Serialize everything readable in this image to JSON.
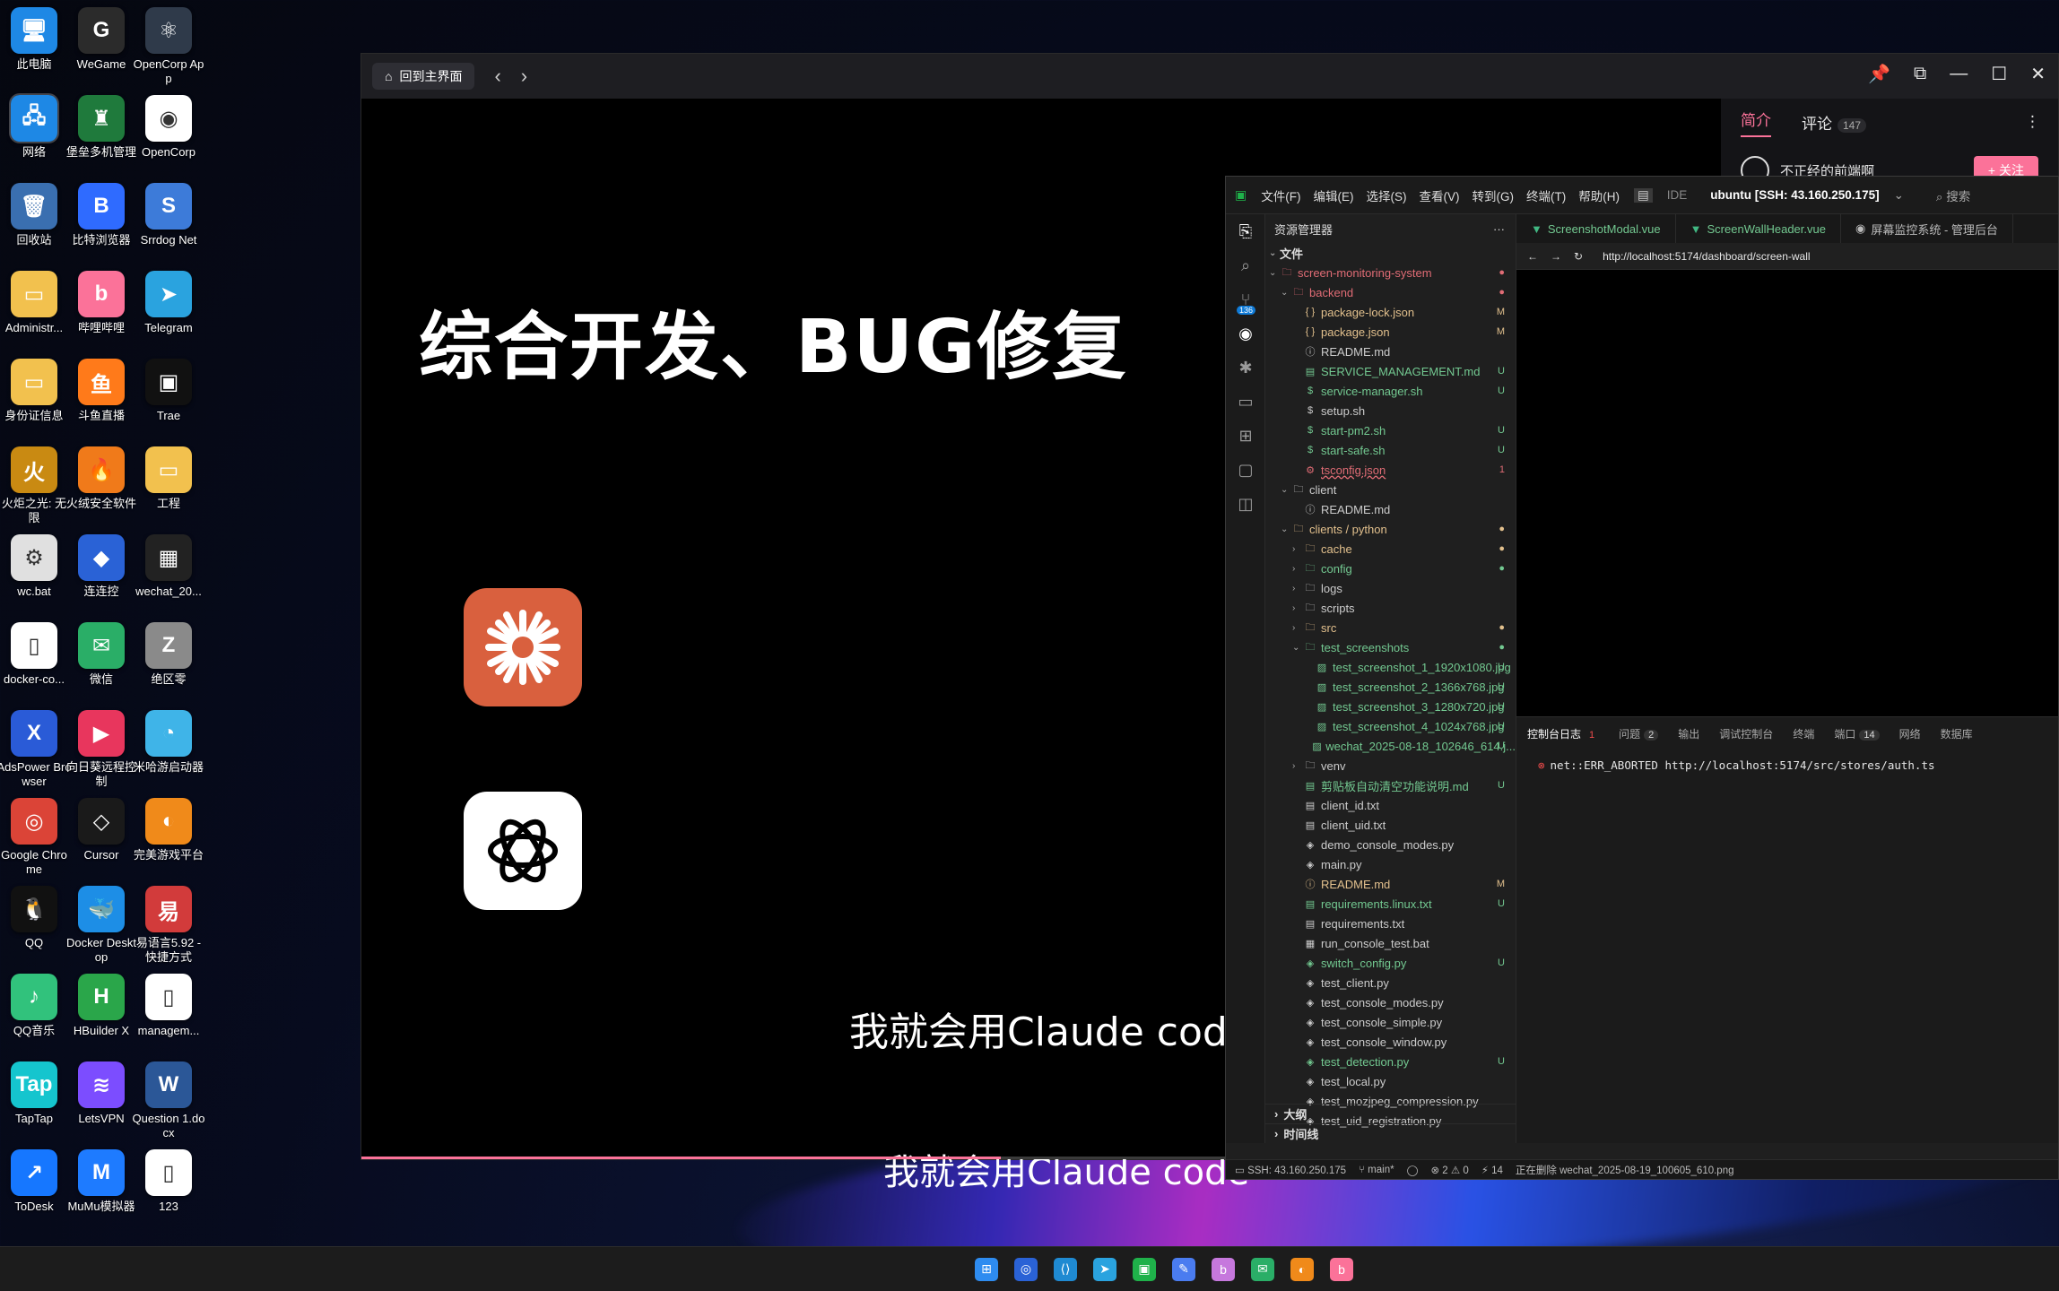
{
  "desktop": {
    "icons": [
      {
        "label": "此电脑",
        "glyph": "🖥",
        "color": "#1e88e5"
      },
      {
        "label": "WeGame",
        "glyph": "G",
        "color": "#2b2b2b"
      },
      {
        "label": "OpenCorp App",
        "glyph": "⚛",
        "color": "#2f3a4a"
      },
      {
        "label": "网络",
        "glyph": "🖧",
        "color": "#1e88e5"
      },
      {
        "label": "堡垒多机管理",
        "glyph": "♜",
        "color": "#1f7a3c"
      },
      {
        "label": "OpenCorp",
        "glyph": "◉",
        "color": "#ffffff"
      },
      {
        "label": "回收站",
        "glyph": "🗑",
        "color": "#3a6fb0"
      },
      {
        "label": "比特浏览器",
        "glyph": "B",
        "color": "#2f6bff"
      },
      {
        "label": "Srrdog Net",
        "glyph": "S",
        "color": "#3d7bd9"
      },
      {
        "label": "Administr...",
        "glyph": "▭",
        "color": "#f2c14e"
      },
      {
        "label": "哔哩哔哩",
        "glyph": "b",
        "color": "#fb7299"
      },
      {
        "label": "Telegram",
        "glyph": "➤",
        "color": "#2aa3df"
      },
      {
        "label": "身份证信息",
        "glyph": "▭",
        "color": "#f2c14e"
      },
      {
        "label": "斗鱼直播",
        "glyph": "鱼",
        "color": "#ff7a1a"
      },
      {
        "label": "Trae",
        "glyph": "▣",
        "color": "#111111"
      },
      {
        "label": "火炬之光: 无限",
        "glyph": "火",
        "color": "#c98a12"
      },
      {
        "label": "火绒安全软件",
        "glyph": "🔥",
        "color": "#f07a1a"
      },
      {
        "label": "工程",
        "glyph": "▭",
        "color": "#f2c14e"
      },
      {
        "label": "wc.bat",
        "glyph": "⚙",
        "color": "#e0e0e0"
      },
      {
        "label": "连连控",
        "glyph": "◆",
        "color": "#2a62d6"
      },
      {
        "label": "wechat_20...",
        "glyph": "▦",
        "color": "#222222"
      },
      {
        "label": "docker-co...",
        "glyph": "▯",
        "color": "#ffffff"
      },
      {
        "label": "微信",
        "glyph": "✉",
        "color": "#2aae67"
      },
      {
        "label": "绝区零",
        "glyph": "Z",
        "color": "#8a8a8a"
      },
      {
        "label": "AdsPower Browser",
        "glyph": "X",
        "color": "#2a5bd7"
      },
      {
        "label": "向日葵远程控制",
        "glyph": "▶",
        "color": "#e8365d"
      },
      {
        "label": "米哈游启动器",
        "glyph": "◔",
        "color": "#3fb4e8"
      },
      {
        "label": "Google Chrome",
        "glyph": "◎",
        "color": "#db4437"
      },
      {
        "label": "Cursor",
        "glyph": "◇",
        "color": "#1a1a1a"
      },
      {
        "label": "完美游戏平台",
        "glyph": "◐",
        "color": "#f08a1a"
      },
      {
        "label": "QQ",
        "glyph": "🐧",
        "color": "#111111"
      },
      {
        "label": "Docker Desktop",
        "glyph": "🐳",
        "color": "#1d8ee6"
      },
      {
        "label": "易语言5.92 - 快捷方式",
        "glyph": "易",
        "color": "#d23b3b"
      },
      {
        "label": "QQ音乐",
        "glyph": "♪",
        "color": "#31c27c"
      },
      {
        "label": "HBuilder X",
        "glyph": "H",
        "color": "#2aa64a"
      },
      {
        "label": "managem...",
        "glyph": "▯",
        "color": "#ffffff"
      },
      {
        "label": "TapTap",
        "glyph": "Tap",
        "color": "#15c5ce"
      },
      {
        "label": "LetsVPN",
        "glyph": "≋",
        "color": "#7c4dff"
      },
      {
        "label": "Question 1.docx",
        "glyph": "W",
        "color": "#2b5797"
      },
      {
        "label": "ToDesk",
        "glyph": "↗",
        "color": "#1677ff"
      },
      {
        "label": "MuMu模拟器",
        "glyph": "M",
        "color": "#1e7bff"
      },
      {
        "label": "123",
        "glyph": "▯",
        "color": "#ffffff"
      }
    ]
  },
  "player": {
    "home_label": "回到主界面",
    "video_title": "综合开发、BUG修复",
    "subtitle_1": "我就会用Claude code",
    "subtitle_2": "我就会用Claude code",
    "progress": 0.47,
    "tab_intro": "简介",
    "tab_comments": "评论",
    "comment_count": "147",
    "uploader_name": "不正经的前端啊",
    "follow_label": "+ 关注"
  },
  "ide": {
    "menus": [
      "文件(F)",
      "编辑(E)",
      "选择(S)",
      "查看(V)",
      "转到(G)",
      "终端(T)",
      "帮助(H)"
    ],
    "mode_label": "IDE",
    "ssh_label": "ubuntu [SSH: 43.160.250.175]",
    "search_label": "搜索",
    "explorer_title": "资源管理器",
    "files_section": "文件",
    "activity_badge": "136",
    "tree": [
      {
        "depth": 0,
        "type": "folder",
        "open": true,
        "name": "screen-monitoring-system",
        "color": "c-red",
        "status": "●",
        "status_color": "c-red"
      },
      {
        "depth": 1,
        "type": "folder",
        "open": true,
        "name": "backend",
        "color": "c-red",
        "status": "●",
        "status_color": "c-red"
      },
      {
        "depth": 2,
        "type": "file",
        "icon": "{ }",
        "name": "package-lock.json",
        "color": "c-yellow",
        "status": "M",
        "status_color": "c-m"
      },
      {
        "depth": 2,
        "type": "file",
        "icon": "{ }",
        "name": "package.json",
        "color": "c-yellow",
        "status": "M",
        "status_color": "c-m"
      },
      {
        "depth": 2,
        "type": "file",
        "icon": "ⓘ",
        "name": "README.md",
        "color": "c-white",
        "status": "",
        "status_color": "c-u"
      },
      {
        "depth": 2,
        "type": "file",
        "icon": "▤",
        "name": "SERVICE_MANAGEMENT.md",
        "color": "c-green",
        "status": "U",
        "status_color": "c-u"
      },
      {
        "depth": 2,
        "type": "file",
        "icon": "$",
        "name": "service-manager.sh",
        "color": "c-green",
        "status": "U",
        "status_color": "c-u"
      },
      {
        "depth": 2,
        "type": "file",
        "icon": "$",
        "name": "setup.sh",
        "color": "c-white",
        "status": "",
        "status_color": "c-u"
      },
      {
        "depth": 2,
        "type": "file",
        "icon": "$",
        "name": "start-pm2.sh",
        "color": "c-green",
        "status": "U",
        "status_color": "c-u"
      },
      {
        "depth": 2,
        "type": "file",
        "icon": "$",
        "name": "start-safe.sh",
        "color": "c-green",
        "status": "U",
        "status_color": "c-u"
      },
      {
        "depth": 2,
        "type": "file",
        "icon": "⚙",
        "name": "tsconfig.json",
        "color": "c-red",
        "status": "1",
        "status_color": "c-red"
      },
      {
        "depth": 1,
        "type": "folder",
        "open": true,
        "name": "client",
        "color": "c-white",
        "status": "",
        "status_color": "c-u"
      },
      {
        "depth": 2,
        "type": "file",
        "icon": "ⓘ",
        "name": "README.md",
        "color": "c-white",
        "status": "",
        "status_color": "c-u"
      },
      {
        "depth": 1,
        "type": "folder",
        "open": true,
        "name": "clients / python",
        "color": "c-yellow",
        "status": "●",
        "status_color": "c-m"
      },
      {
        "depth": 2,
        "type": "folder",
        "open": false,
        "name": "cache",
        "color": "c-yellow",
        "status": "●",
        "status_color": "c-m"
      },
      {
        "depth": 2,
        "type": "folder",
        "open": false,
        "name": "config",
        "color": "c-green",
        "status": "●",
        "status_color": "c-u"
      },
      {
        "depth": 2,
        "type": "folder",
        "open": false,
        "name": "logs",
        "color": "c-white",
        "status": "",
        "status_color": "c-u"
      },
      {
        "depth": 2,
        "type": "folder",
        "open": false,
        "name": "scripts",
        "color": "c-white",
        "status": "",
        "status_color": "c-u"
      },
      {
        "depth": 2,
        "type": "folder",
        "open": false,
        "name": "src",
        "color": "c-yellow",
        "status": "●",
        "status_color": "c-m"
      },
      {
        "depth": 2,
        "type": "folder",
        "open": true,
        "name": "test_screenshots",
        "color": "c-green",
        "status": "●",
        "status_color": "c-u"
      },
      {
        "depth": 3,
        "type": "file",
        "icon": "▨",
        "name": "test_screenshot_1_1920x1080.jpg",
        "color": "c-green",
        "status": "U",
        "status_color": "c-u"
      },
      {
        "depth": 3,
        "type": "file",
        "icon": "▨",
        "name": "test_screenshot_2_1366x768.jpg",
        "color": "c-green",
        "status": "U",
        "status_color": "c-u"
      },
      {
        "depth": 3,
        "type": "file",
        "icon": "▨",
        "name": "test_screenshot_3_1280x720.jpg",
        "color": "c-green",
        "status": "U",
        "status_color": "c-u"
      },
      {
        "depth": 3,
        "type": "file",
        "icon": "▨",
        "name": "test_screenshot_4_1024x768.jpg",
        "color": "c-green",
        "status": "U",
        "status_color": "c-u"
      },
      {
        "depth": 3,
        "type": "file",
        "icon": "▨",
        "name": "wechat_2025-08-18_102646_614.j...",
        "color": "c-green",
        "status": "U",
        "status_color": "c-u"
      },
      {
        "depth": 2,
        "type": "folder",
        "open": false,
        "name": "venv",
        "color": "c-white",
        "status": "",
        "status_color": "c-u"
      },
      {
        "depth": 2,
        "type": "file",
        "icon": "▤",
        "name": "剪贴板自动清空功能说明.md",
        "color": "c-green",
        "status": "U",
        "status_color": "c-u"
      },
      {
        "depth": 2,
        "type": "file",
        "icon": "▤",
        "name": "client_id.txt",
        "color": "c-white",
        "status": "",
        "status_color": "c-u"
      },
      {
        "depth": 2,
        "type": "file",
        "icon": "▤",
        "name": "client_uid.txt",
        "color": "c-white",
        "status": "",
        "status_color": "c-u"
      },
      {
        "depth": 2,
        "type": "file",
        "icon": "◈",
        "name": "demo_console_modes.py",
        "color": "c-white",
        "status": "",
        "status_color": "c-u"
      },
      {
        "depth": 2,
        "type": "file",
        "icon": "◈",
        "name": "main.py",
        "color": "c-white",
        "status": "",
        "status_color": "c-u"
      },
      {
        "depth": 2,
        "type": "file",
        "icon": "ⓘ",
        "name": "README.md",
        "color": "c-yellow",
        "status": "M",
        "status_color": "c-m"
      },
      {
        "depth": 2,
        "type": "file",
        "icon": "▤",
        "name": "requirements.linux.txt",
        "color": "c-green",
        "status": "U",
        "status_color": "c-u"
      },
      {
        "depth": 2,
        "type": "file",
        "icon": "▤",
        "name": "requirements.txt",
        "color": "c-white",
        "status": "",
        "status_color": "c-u"
      },
      {
        "depth": 2,
        "type": "file",
        "icon": "▦",
        "name": "run_console_test.bat",
        "color": "c-white",
        "status": "",
        "status_color": "c-u"
      },
      {
        "depth": 2,
        "type": "file",
        "icon": "◈",
        "name": "switch_config.py",
        "color": "c-green",
        "status": "U",
        "status_color": "c-u"
      },
      {
        "depth": 2,
        "type": "file",
        "icon": "◈",
        "name": "test_client.py",
        "color": "c-white",
        "status": "",
        "status_color": "c-u"
      },
      {
        "depth": 2,
        "type": "file",
        "icon": "◈",
        "name": "test_console_modes.py",
        "color": "c-white",
        "status": "",
        "status_color": "c-u"
      },
      {
        "depth": 2,
        "type": "file",
        "icon": "◈",
        "name": "test_console_simple.py",
        "color": "c-white",
        "status": "",
        "status_color": "c-u"
      },
      {
        "depth": 2,
        "type": "file",
        "icon": "◈",
        "name": "test_console_window.py",
        "color": "c-white",
        "status": "",
        "status_color": "c-u"
      },
      {
        "depth": 2,
        "type": "file",
        "icon": "◈",
        "name": "test_detection.py",
        "color": "c-green",
        "status": "U",
        "status_color": "c-u"
      },
      {
        "depth": 2,
        "type": "file",
        "icon": "◈",
        "name": "test_local.py",
        "color": "c-white",
        "status": "",
        "status_color": "c-u"
      },
      {
        "depth": 2,
        "type": "file",
        "icon": "◈",
        "name": "test_mozjpeg_compression.py",
        "color": "c-white",
        "status": "",
        "status_color": "c-u"
      },
      {
        "depth": 2,
        "type": "file",
        "icon": "◈",
        "name": "test_uid_registration.py",
        "color": "c-white",
        "status": "",
        "status_color": "c-u"
      }
    ],
    "outline_label": "大纲",
    "timeline_label": "时间线",
    "tabs": [
      "ScreenshotModal.vue",
      "ScreenWallHeader.vue",
      "屏幕监控系统 - 管理后台"
    ],
    "url": "http://localhost:5174/dashboard/screen-wall",
    "panel_tabs": [
      {
        "label": "控制台日志",
        "count": "1"
      },
      {
        "label": "问题",
        "count": "2"
      },
      {
        "label": "输出",
        "count": ""
      },
      {
        "label": "调试控制台",
        "count": ""
      },
      {
        "label": "终端",
        "count": ""
      },
      {
        "label": "端口",
        "count": "14"
      },
      {
        "label": "网络",
        "count": ""
      },
      {
        "label": "数据库",
        "count": ""
      }
    ],
    "log_text": "net::ERR_ABORTED http://localhost:5174/src/stores/auth.ts",
    "status": {
      "ssh": "SSH: 43.160.250.175",
      "branch": "main*",
      "errors": "2",
      "warnings": "0",
      "ports": "14",
      "message": "正在删除 wechat_2025-08-19_100605_610.png"
    }
  },
  "taskbar": {
    "apps": [
      {
        "name": "start-icon",
        "glyph": "⊞",
        "color": "#2e8cf0"
      },
      {
        "name": "browser-icon",
        "glyph": "◎",
        "color": "#2a62d6"
      },
      {
        "name": "vscode-icon",
        "glyph": "⟨⟩",
        "color": "#1f8ad2"
      },
      {
        "name": "telegram-icon",
        "glyph": "➤",
        "color": "#2aa3df"
      },
      {
        "name": "trae-icon",
        "glyph": "▣",
        "color": "#1fb14a"
      },
      {
        "name": "notes-icon",
        "glyph": "✎",
        "color": "#4a7cf0"
      },
      {
        "name": "bilibili-icon",
        "glyph": "b",
        "color": "#c678dd"
      },
      {
        "name": "wechat-icon",
        "glyph": "✉",
        "color": "#2aae67"
      },
      {
        "name": "game-icon",
        "glyph": "◐",
        "color": "#f08a1a"
      },
      {
        "name": "bilibili-live-icon",
        "glyph": "b",
        "color": "#fb7299"
      }
    ]
  }
}
